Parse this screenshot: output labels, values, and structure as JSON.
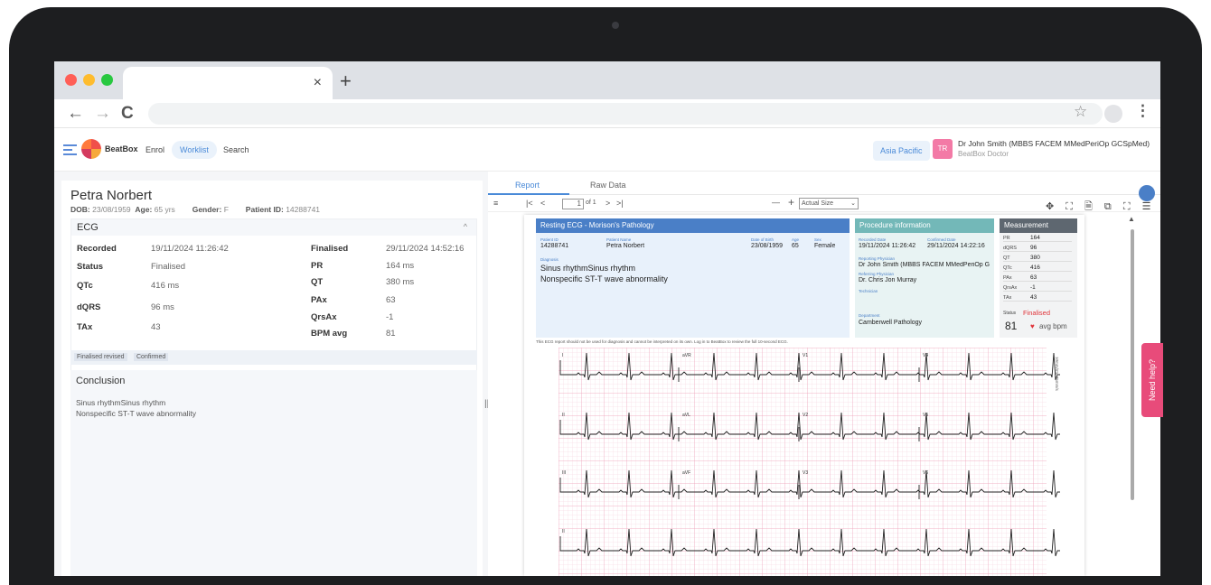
{
  "browser": {
    "tab_close": "×",
    "new_tab": "+",
    "back": "←",
    "forward": "→",
    "reload": "C",
    "star": "☆",
    "menu": "⋮"
  },
  "app": {
    "logo_text": "BeatBox",
    "nav": [
      "Enrol",
      "Worklist",
      "Search"
    ],
    "region": "Asia Pacific",
    "avatar_initials": "TR",
    "user_name": "Dr John Smith (MBBS FACEM MMedPeriOp GCSpMed)",
    "user_role": "BeatBox Doctor"
  },
  "patient": {
    "name": "Petra Norbert",
    "dob_label": "DOB:",
    "dob": "23/08/1959",
    "age_label": "Age:",
    "age": "65 yrs",
    "gender_label": "Gender:",
    "gender": "F",
    "id_label": "Patient ID:",
    "id": "14288741"
  },
  "ecg_panel": {
    "title": "ECG",
    "chevron": "^",
    "left_rows": [
      {
        "label": "Recorded",
        "value": "19/11/2024 11:26:42"
      },
      {
        "label": "Status",
        "value": "Finalised"
      },
      {
        "label": "QTc",
        "value": "416 ms"
      },
      {
        "label": "dQRS",
        "value": "96 ms"
      },
      {
        "label": "TAx",
        "value": "43"
      }
    ],
    "right_rows": [
      {
        "label": "Finalised",
        "value": "29/11/2024 14:52:16"
      },
      {
        "label": "PR",
        "value": "164 ms"
      },
      {
        "label": "QT",
        "value": "380 ms"
      },
      {
        "label": "PAx",
        "value": "63"
      },
      {
        "label": "QrsAx",
        "value": "-1"
      },
      {
        "label": "BPM avg",
        "value": "81"
      }
    ],
    "tags": [
      "Finalised revised",
      "Confirmed"
    ]
  },
  "conclusion": {
    "title": "Conclusion",
    "lines": [
      "Sinus rhythmSinus rhythm",
      "Nonspecific ST-T wave abnormality"
    ]
  },
  "viewer": {
    "tabs": [
      "Report",
      "Raw Data"
    ],
    "pdf": {
      "menu": "≡",
      "first": "|<",
      "prev": "<",
      "page": "1",
      "of": "of 1",
      "next": ">",
      "last": ">|",
      "zoom_out": "—",
      "zoom_in": "+",
      "zoom": "Actual Size",
      "tool_icons": "✥ ⛶ 🗎 ⧉ ⛶ ☰"
    }
  },
  "report": {
    "title": "Resting ECG -  Morison's Pathology",
    "patient_id_label": "Patient ID",
    "patient_id": "14288741",
    "patient_name_label": "Patient Name",
    "patient_name": "Petra  Norbert",
    "dob_label": "Date of Birth",
    "dob": "23/08/1959",
    "age_label": "Age",
    "age": "65",
    "sex_label": "Sex",
    "sex": "Female",
    "diagnosis_label": "Diagnosis",
    "diagnosis": [
      "Sinus rhythmSinus rhythm",
      "Nonspecific ST-T wave abnormality"
    ],
    "procedure_title": "Procedure information",
    "recorded_label": "Recorded Date",
    "recorded": "19/11/2024 11:26:42",
    "confirmed_label": "Confirmed Date",
    "confirmed": "29/11/2024 14:22:16",
    "reporting_label": "Reporting Physician",
    "reporting": "Dr John Smith (MBBS FACEM MMedPeriOp G",
    "referring_label": "Referring Physician",
    "referring": "Dr. Chris Jon Murray",
    "technician_label": "Technician",
    "department_label": "Department",
    "department": "Camberwell Pathology",
    "measurement_title": "Measurement",
    "measurements": [
      {
        "k": "PR",
        "v": "164"
      },
      {
        "k": "dQRS",
        "v": "96"
      },
      {
        "k": "QT",
        "v": "380"
      },
      {
        "k": "QTc",
        "v": "416"
      },
      {
        "k": "PAx",
        "v": "63"
      },
      {
        "k": "QrsAx",
        "v": "-1"
      },
      {
        "k": "TAx",
        "v": "43"
      }
    ],
    "status_label": "Status",
    "status": "Finalised",
    "bpm": "81",
    "bpm_unit": "avg bpm",
    "disclaimer": "This ECG report should not be used for diagnosis and cannot be interpreted on its own. Log in to BeatBox to review the full 10-second ECG.",
    "leads": [
      [
        "I",
        "aVR",
        "V1",
        "V4"
      ],
      [
        "II",
        "aVL",
        "V2",
        "V5"
      ],
      [
        "III",
        "aVF",
        "V3",
        "V6"
      ],
      [
        "II",
        "",
        "",
        ""
      ]
    ],
    "side_text": "10mm/mV 25mm/s"
  },
  "help": "Need help?",
  "colors": {
    "accent": "#4a8ad8",
    "report_blue": "#4a7fc7",
    "teal": "#73b8b8",
    "status_red": "#e0343a",
    "ecg_grid": "#f4c6d6"
  }
}
